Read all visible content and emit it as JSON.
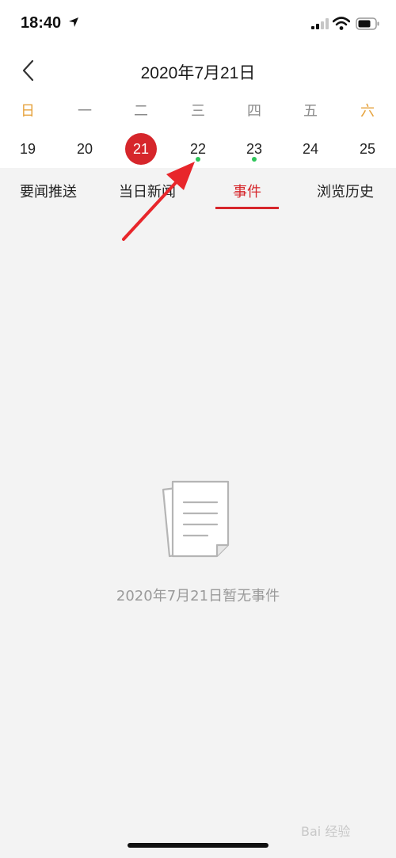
{
  "status_bar": {
    "time": "18:40"
  },
  "header": {
    "title": "2020年7月21日",
    "back_icon": "chevron-left-icon"
  },
  "calendar": {
    "weekdays": [
      "日",
      "一",
      "二",
      "三",
      "四",
      "五",
      "六"
    ],
    "days": [
      "19",
      "20",
      "21",
      "22",
      "23",
      "24",
      "25"
    ],
    "selected_day": "21",
    "days_with_events": [
      "22",
      "23"
    ],
    "selected_color": "#d6262b",
    "weekend_color": "#e6a23c",
    "event_dot_color": "#2ec55a"
  },
  "tabs": [
    {
      "label": "要闻推送"
    },
    {
      "label": "当日新闻"
    },
    {
      "label": "事件",
      "active": true
    },
    {
      "label": "浏览历史"
    }
  ],
  "empty_state": {
    "icon": "document-icon",
    "message": "2020年7月21日暂无事件"
  },
  "watermark": "Bai 经验"
}
